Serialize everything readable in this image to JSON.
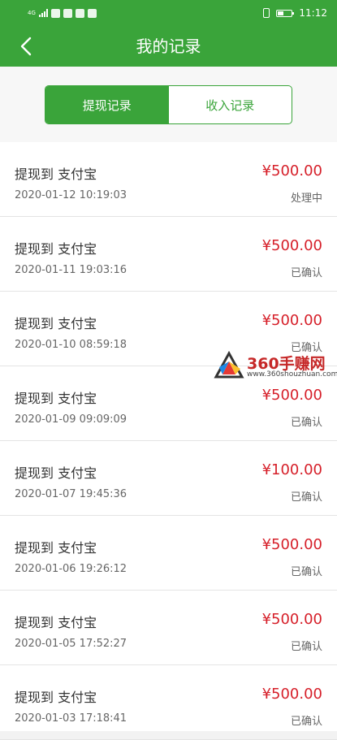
{
  "status_bar": {
    "network_label": "4G",
    "time": "11:12"
  },
  "nav": {
    "title": "我的记录"
  },
  "tabs": [
    {
      "label": "提现记录",
      "active": true
    },
    {
      "label": "收入记录",
      "active": false
    }
  ],
  "records": [
    {
      "title": "提现到 支付宝",
      "time": "2020-01-12 10:19:03",
      "amount": "¥500.00",
      "status": "处理中"
    },
    {
      "title": "提现到 支付宝",
      "time": "2020-01-11 19:03:16",
      "amount": "¥500.00",
      "status": "已确认"
    },
    {
      "title": "提现到 支付宝",
      "time": "2020-01-10 08:59:18",
      "amount": "¥500.00",
      "status": "已确认"
    },
    {
      "title": "提现到 支付宝",
      "time": "2020-01-09 09:09:09",
      "amount": "¥500.00",
      "status": "已确认"
    },
    {
      "title": "提现到 支付宝",
      "time": "2020-01-07 19:45:36",
      "amount": "¥100.00",
      "status": "已确认"
    },
    {
      "title": "提现到 支付宝",
      "time": "2020-01-06 19:26:12",
      "amount": "¥500.00",
      "status": "已确认"
    },
    {
      "title": "提现到 支付宝",
      "time": "2020-01-05 17:52:27",
      "amount": "¥500.00",
      "status": "已确认"
    },
    {
      "title": "提现到 支付宝",
      "time": "2020-01-03 17:18:41",
      "amount": "¥500.00",
      "status": "已确认"
    }
  ],
  "watermark": {
    "brand": "360手赚网",
    "url": "www.360shouzhuan.com"
  },
  "colors": {
    "primary_green": "#3aa43a",
    "amount_red": "#d6202a"
  },
  "icons": {
    "back": "chevron-left-icon"
  }
}
